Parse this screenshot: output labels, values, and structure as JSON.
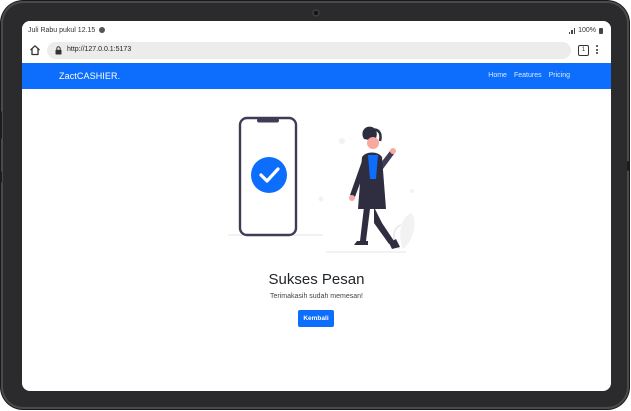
{
  "status_bar": {
    "time": "Juli Rabu pukul 12.15",
    "battery": "100%"
  },
  "browser": {
    "url": "http://127.0.0.1:5173",
    "tab_count": "1",
    "icons": [
      "home-icon",
      "lock-icon",
      "tabs-icon",
      "more-icon"
    ]
  },
  "navbar": {
    "brand": "ZactCASHIER.",
    "links": [
      {
        "label": "Home"
      },
      {
        "label": "Features"
      },
      {
        "label": "Pricing"
      }
    ],
    "color": "#0d6efd"
  },
  "main": {
    "title": "Sukses Pesan",
    "message": "Terimakasih sudah memesan!",
    "back_button": "Kembali"
  },
  "colors": {
    "accent": "#0d6efd",
    "device_frame": "#2b2b2d",
    "illustration_dark": "#3f3d56",
    "illustration_accent": "#0d6efd"
  }
}
